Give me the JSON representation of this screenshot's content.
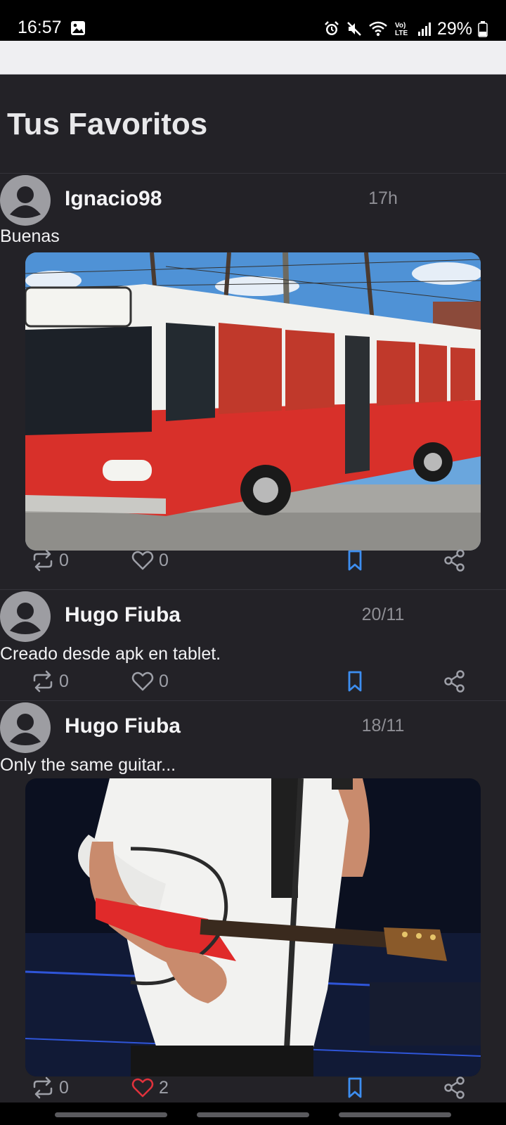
{
  "status_bar": {
    "time": "16:57",
    "battery": "29%",
    "icons": [
      "photo-icon",
      "alarm-icon",
      "mute-icon",
      "wifi-icon",
      "volte-icon",
      "signal-icon",
      "battery-icon"
    ]
  },
  "page": {
    "title": "Tus Favoritos"
  },
  "posts": [
    {
      "user": "Ignacio98",
      "time": "17h",
      "text": "Buenas",
      "image": "red-and-white-school-bus-photo",
      "retweets": "0",
      "likes": "0",
      "liked": false,
      "saved": true
    },
    {
      "user": "Hugo Fiuba",
      "time": "20/11",
      "text": "Creado desde apk en tablet.",
      "image": null,
      "retweets": "0",
      "likes": "0",
      "liked": false,
      "saved": true
    },
    {
      "user": "Hugo Fiuba",
      "time": "18/11",
      "text": "Only the same guitar...",
      "image": "musician-with-red-guitar-photo",
      "retweets": "0",
      "likes": "2",
      "liked": true,
      "saved": true
    }
  ],
  "colors": {
    "background": "#232227",
    "accent_blue": "#3d8ef0",
    "like_red": "#e0323c",
    "muted_icon": "#9ea0a8",
    "timestamp": "#8f8f95",
    "bus_red": "#d8302a"
  }
}
